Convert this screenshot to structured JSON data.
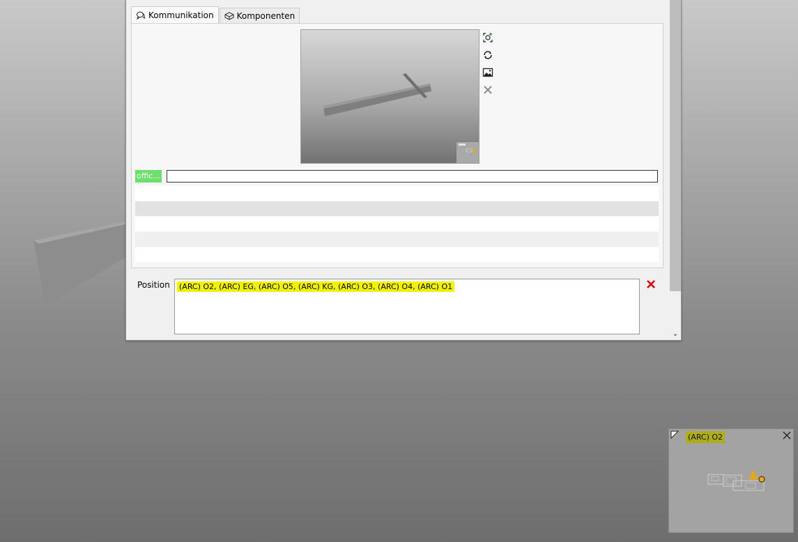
{
  "tabs": [
    {
      "label": "Kommunikation",
      "icon": "speech-bubbles-icon",
      "active": true
    },
    {
      "label": "Komponenten",
      "icon": "component-box-icon",
      "active": false
    }
  ],
  "preview_tools": [
    {
      "name": "add-viewpoint-icon"
    },
    {
      "name": "refresh-icon"
    },
    {
      "name": "image-icon"
    },
    {
      "name": "remove-icon"
    }
  ],
  "comment": {
    "tag_label": "offic...",
    "input_value": "",
    "tag_color": "#6be16b"
  },
  "position": {
    "label": "Position",
    "value": "(ARC) O2, (ARC) EG, (ARC) O5, (ARC) KG, (ARC) O3, (ARC) O4, (ARC) O1",
    "highlight_color": "#f2f200",
    "clear_color": "#e00000"
  },
  "minimap": {
    "label": "(ARC) O2",
    "marker_color": "#f0a800"
  }
}
